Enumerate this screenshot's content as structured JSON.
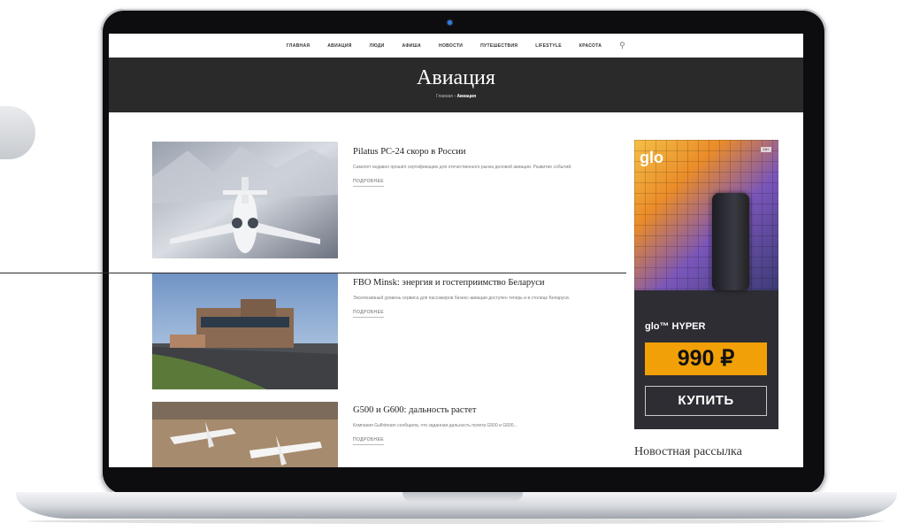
{
  "nav": {
    "items": [
      "ГЛАВНАЯ",
      "АВИАЦИЯ",
      "ЛЮДИ",
      "АФИША",
      "НОВОСТИ",
      "ПУТЕШЕСТВИЯ",
      "LIFESTYLE",
      "КРАСОТА"
    ],
    "search_icon": "search-icon"
  },
  "banner": {
    "title": "Авиация",
    "breadcrumb_home": "Главная",
    "breadcrumb_sep": "›",
    "breadcrumb_current": "Авиация"
  },
  "articles": [
    {
      "title": "Pilatus PC-24 скоро в России",
      "excerpt": "Самолет недавно прошёл сертификацию для отечественного рынка деловой авиации. Развитие событий.",
      "more": "ПОДРОБНЕЕ"
    },
    {
      "title": "FBO Minsk: энергия и гостеприимство Беларуси",
      "excerpt": "Эксклюзивный уровень сервиса для пассажиров бизнес-авиации доступен теперь и в столице Беларуси.",
      "more": "ПОДРОБНЕЕ"
    },
    {
      "title": "G500 и G600: дальность растет",
      "excerpt": "Компания Gulfstream сообщила, что заданная дальность полета G500 и G600...",
      "more": "ПОДРОБНЕЕ"
    }
  ],
  "ad": {
    "brand": "glo",
    "product": "glo™ HYPER",
    "price": "990 ₽",
    "button": "КУПИТЬ",
    "badge": "18+",
    "colors": {
      "price_bg": "#f2a007",
      "panel_bg": "#2d2d33"
    }
  },
  "sidebar": {
    "newsletter_title": "Новостная рассылка"
  }
}
